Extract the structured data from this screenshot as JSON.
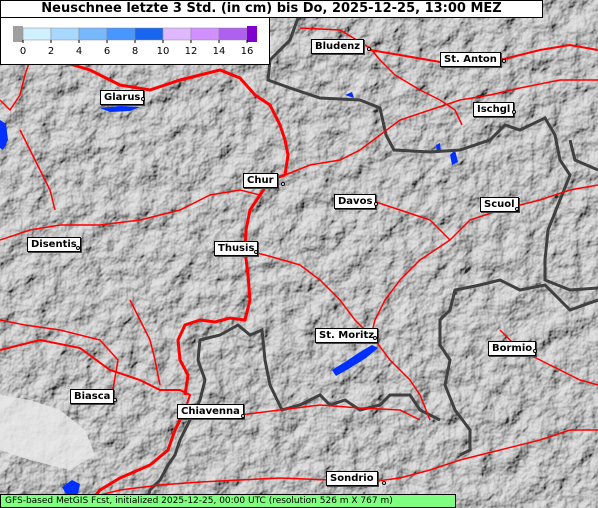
{
  "title": "Neuschnee letzte 3 Std. (in cm) bis Do, 2025-12-25, 13:00 MEZ",
  "legend": {
    "ticks": [
      "0",
      "2",
      "4",
      "6",
      "8",
      "10",
      "12",
      "14",
      "16"
    ],
    "colors": [
      "#d0f0ff",
      "#a8d8ff",
      "#78b8ff",
      "#4896ff",
      "#1866f0",
      "#e0b8ff",
      "#d090ff",
      "#b060f0",
      "#9010e0"
    ],
    "below_color": "#a0a0a0",
    "above_color": "#8000d0"
  },
  "cities": [
    {
      "name": "Bludenz"
    },
    {
      "name": "St. Anton"
    },
    {
      "name": "Glarus"
    },
    {
      "name": "Ischgl"
    },
    {
      "name": "Chur"
    },
    {
      "name": "Davos"
    },
    {
      "name": "Scuol"
    },
    {
      "name": "Disentis"
    },
    {
      "name": "Thusis"
    },
    {
      "name": "St. Moritz"
    },
    {
      "name": "Bormio"
    },
    {
      "name": "Biasca"
    },
    {
      "name": "Chiavenna"
    },
    {
      "name": "Sondrio"
    }
  ],
  "footer": "GFS-based MetGIS Fcst, initialized 2025-12-25, 00:00 UTC  (resolution 526 m X 767 m)",
  "colors": {
    "road": "#ff0000",
    "border": "#404040",
    "lake": "#0030ff",
    "footer_bg": "#80ff80"
  }
}
